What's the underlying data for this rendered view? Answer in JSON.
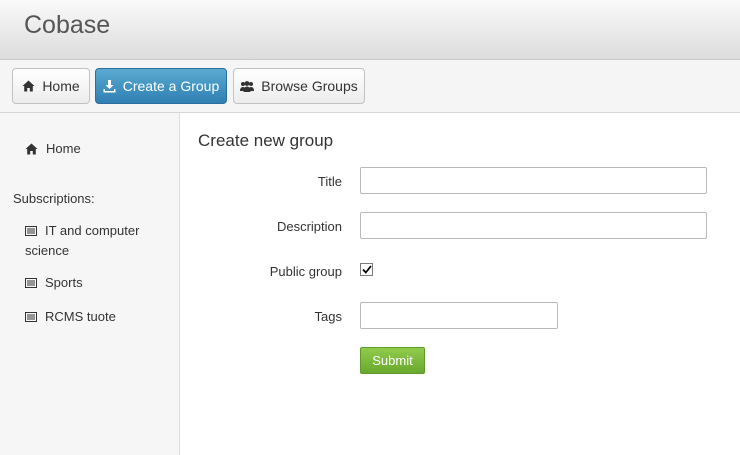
{
  "header": {
    "brand": "Cobase"
  },
  "toolbar": {
    "home_label": "Home",
    "create_label": "Create a Group",
    "browse_label": "Browse Groups"
  },
  "sidebar": {
    "home_label": "Home",
    "subscriptions_heading": "Subscriptions:",
    "subscriptions": [
      {
        "label": "IT and computer science"
      },
      {
        "label": "Sports"
      },
      {
        "label": "RCMS tuote"
      }
    ]
  },
  "form": {
    "title": "Create new group",
    "title_label": "Title",
    "title_value": "",
    "description_label": "Description",
    "description_value": "",
    "public_label": "Public group",
    "public_checked": true,
    "tags_label": "Tags",
    "tags_value": "",
    "submit_label": "Submit"
  },
  "colors": {
    "active_button": "#3a8cc0",
    "submit_button": "#78b83d",
    "sidebar_bg": "#f6f6f6"
  },
  "icons": [
    "home-icon",
    "download-icon",
    "group-icon",
    "list-icon",
    "checkmark-icon"
  ]
}
